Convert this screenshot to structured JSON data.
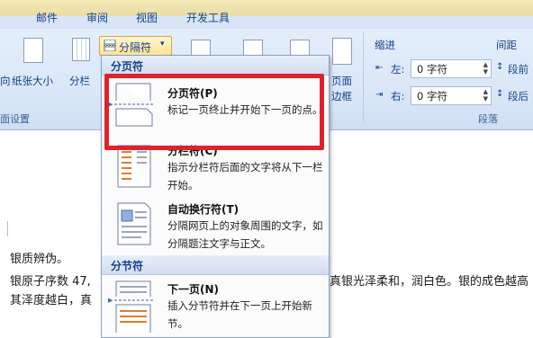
{
  "tabs": [
    "邮件",
    "审阅",
    "视图",
    "开发工具"
  ],
  "ribbon": {
    "page_setup": {
      "left_cut_label": "向",
      "size_label": "纸张大小",
      "columns_label": "分栏",
      "caption": "面设置"
    },
    "breaks_button": {
      "label": "分隔符",
      "arrow": "▾"
    },
    "page_borders_label_line1": "页面",
    "page_borders_label_line2": "边框",
    "indent": {
      "header": "缩进",
      "left_label": "左:",
      "left_value": "0 字符",
      "right_label": "右:",
      "right_value": "0 字符"
    },
    "spacing": {
      "header": "间距",
      "before_label": "段前",
      "after_label": "段后"
    },
    "paragraph_caption": "段落"
  },
  "menu": {
    "page_breaks_header": "分页符",
    "section_breaks_header": "分节符",
    "items": [
      {
        "title": "分页符(P)",
        "desc": "标记一页终止并开始下一页的点。"
      },
      {
        "title": "分栏符(C)",
        "desc": "指示分栏符后面的文字将从下一栏开始。"
      },
      {
        "title": "自动换行符(T)",
        "desc": "分隔网页上的对象周围的文字，如分隔题注文字与正文。"
      },
      {
        "title": "下一页(N)",
        "desc": "插入分节符并在下一页上开始新节。"
      }
    ]
  },
  "document": {
    "line1": "银质辨伪。",
    "line2_left": "银原子序数 47,",
    "line2_right": "真银光泽柔和，润白色。银的成色越高",
    "line3_left": "其泽度越白，真",
    "line3_right": ""
  },
  "colors": {
    "highlight_box": "#e0212b",
    "ribbon_text": "#15428b",
    "menu_header_bg": "#d2def0"
  }
}
